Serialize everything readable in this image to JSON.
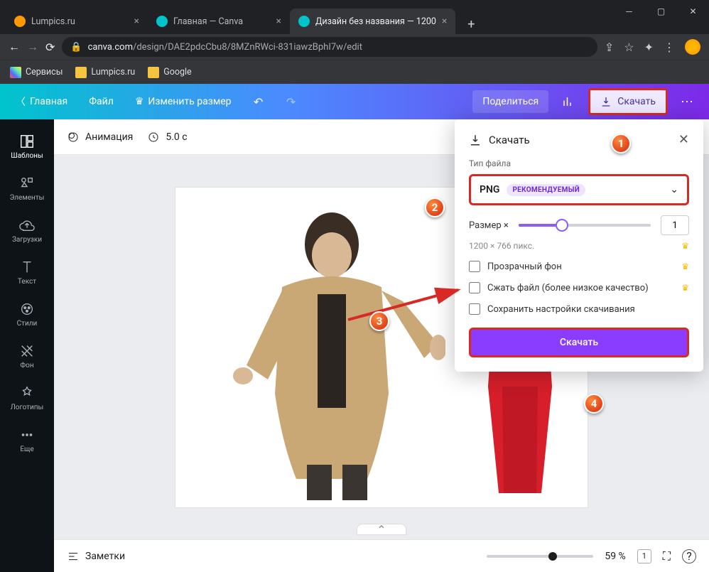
{
  "browser": {
    "tabs": [
      {
        "title": "Lumpics.ru",
        "favicon_color": "#ff9a00"
      },
      {
        "title": "Главная — Canva",
        "favicon_color": "#00c4cc"
      },
      {
        "title": "Дизайн без названия — 1200",
        "favicon_color": "#00c4cc"
      }
    ],
    "url_domain": "canva.com",
    "url_path": "/design/DAE2pdcCbu8/8MZnRWci-831iawzBphI7w/edit",
    "bookmarks": [
      {
        "label": "Сервисы"
      },
      {
        "label": "Lumpics.ru"
      },
      {
        "label": "Google"
      }
    ]
  },
  "header": {
    "home": "Главная",
    "file": "Файл",
    "resize": "Изменить размер",
    "share": "Поделиться",
    "download": "Скачать"
  },
  "sidebar": {
    "items": [
      {
        "label": "Шаблоны"
      },
      {
        "label": "Элементы"
      },
      {
        "label": "Загрузки"
      },
      {
        "label": "Текст"
      },
      {
        "label": "Стили"
      },
      {
        "label": "Фон"
      },
      {
        "label": "Логотипы"
      },
      {
        "label": "Еще"
      }
    ]
  },
  "canvas_topbar": {
    "animation": "Анимация",
    "duration": "5.0 с"
  },
  "download_panel": {
    "title": "Скачать",
    "file_type_label": "Тип файла",
    "file_type": "PNG",
    "recommended": "РЕКОМЕНДУЕМЫЙ",
    "size_label": "Размер ×",
    "size_value": "1",
    "dimensions": "1200 × 766 пикс.",
    "transparent_bg": "Прозрачный фон",
    "compress": "Сжать файл (более низкое качество)",
    "save_settings": "Сохранить настройки скачивания",
    "download_btn": "Скачать"
  },
  "footer": {
    "notes": "Заметки",
    "zoom": "59 %",
    "page": "1"
  },
  "annotations": {
    "a1": "1",
    "a2": "2",
    "a3": "3",
    "a4": "4"
  }
}
